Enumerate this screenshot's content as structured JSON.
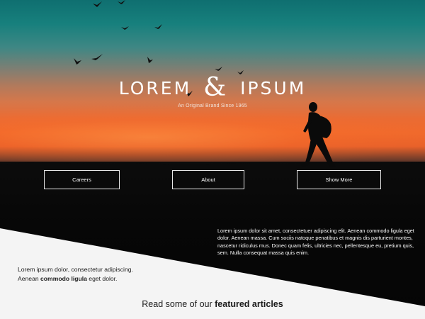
{
  "hero": {
    "brand_left": "LOREM",
    "brand_amp": "&",
    "brand_right": "IPSUM",
    "tagline": "An Original Brand Since 1965"
  },
  "nav": {
    "careers": "Careers",
    "about": "About",
    "show_more": "Show More"
  },
  "dark_section": {
    "paragraph": "Lorem ipsum dolor sit amet, consectetuer adipiscing elit. Aenean commodo ligula eget dolor. Aenean massa. Cum sociis natoque penatibus et magnis dis parturient montes, nascetur ridiculus mus. Donec quam felis, ultricies nec, pellentesque eu, pretium quis, sem. Nulla consequat massa quis enim."
  },
  "light_section": {
    "line1": "Lorem ipsum dolor, consectetur adipiscing.",
    "line2_pre": "Aenean ",
    "line2_bold": "commodo ligula",
    "line2_post": " eget dolor."
  },
  "featured": {
    "pre": "Read some of our ",
    "bold": "featured articles"
  },
  "colors": {
    "sky_top": "#0f6f70",
    "sunset_orange": "#f06a2c",
    "ground": "#070707",
    "light_panel": "#f4f4f4"
  },
  "icons": {
    "bird": "bird-icon",
    "hiker": "hiker-silhouette"
  }
}
